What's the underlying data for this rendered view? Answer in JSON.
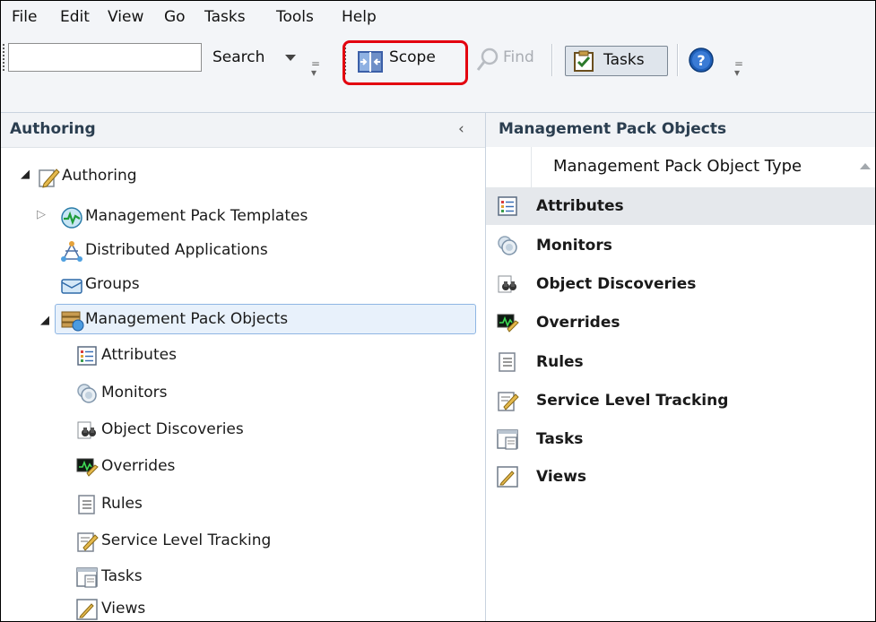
{
  "menu": [
    "File",
    "Edit",
    "View",
    "Go",
    "Tasks",
    "Tools",
    "Help"
  ],
  "toolbar": {
    "search_value": "",
    "search_label": "Search",
    "scope_label": "Scope",
    "find_label": "Find",
    "tasks_label": "Tasks",
    "help_icon": "help-icon"
  },
  "left_pane": {
    "title": "Authoring",
    "collapse_glyph": "‹",
    "tree": {
      "root": "Authoring",
      "mp_templates": "Management Pack Templates",
      "distributed_apps": "Distributed Applications",
      "groups": "Groups",
      "mp_objects": "Management Pack Objects",
      "children": [
        "Attributes",
        "Monitors",
        "Object Discoveries",
        "Overrides",
        "Rules",
        "Service Level Tracking",
        "Tasks",
        "Views"
      ]
    }
  },
  "right_pane": {
    "title": "Management Pack Objects",
    "column_header": "Management Pack Object Type",
    "rows": [
      "Attributes",
      "Monitors",
      "Object Discoveries",
      "Overrides",
      "Rules",
      "Service Level Tracking",
      "Tasks",
      "Views"
    ],
    "selected_row": "Attributes"
  },
  "colors": {
    "highlight": "#e3000f",
    "selection_border": "#8fb6e4",
    "header_text": "#2b3e50"
  }
}
